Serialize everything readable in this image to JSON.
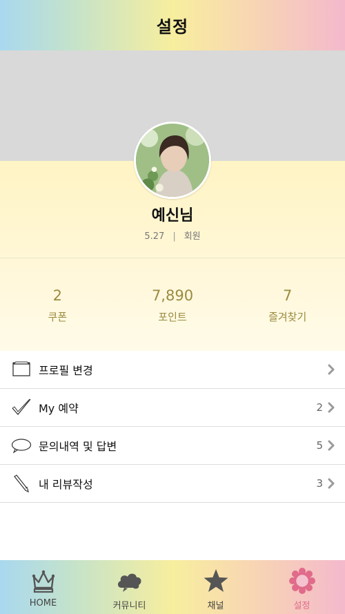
{
  "header": {
    "title": "설정"
  },
  "profile": {
    "name": "예신님",
    "date": "5.27",
    "separator": "|",
    "grade": "회원"
  },
  "stats": [
    {
      "value": "2",
      "label": "쿠폰"
    },
    {
      "value": "7,890",
      "label": "포인트"
    },
    {
      "value": "7",
      "label": "즐겨찾기"
    }
  ],
  "menu": [
    {
      "label": "프로필 변경",
      "count": "",
      "icon": "frame-icon"
    },
    {
      "label": "My 예약",
      "count": "2",
      "icon": "checkmark-icon"
    },
    {
      "label": "문의내역 및 답변",
      "count": "5",
      "icon": "speech-bubble-icon"
    },
    {
      "label": "내 리뷰작성",
      "count": "3",
      "icon": "pencil-icon"
    }
  ],
  "tabs": [
    {
      "label": "HOME",
      "icon": "crown-icon"
    },
    {
      "label": "커뮤니티",
      "icon": "cloud-icon"
    },
    {
      "label": "채널",
      "icon": "star-icon"
    },
    {
      "label": "설정",
      "icon": "flower-icon",
      "active": true
    }
  ],
  "colors": {
    "accent_gold": "#9a8a3f",
    "active_pink": "#e06b8a",
    "cover_gray": "#d9d9d9",
    "profile_yellow": "#fff4c4"
  }
}
